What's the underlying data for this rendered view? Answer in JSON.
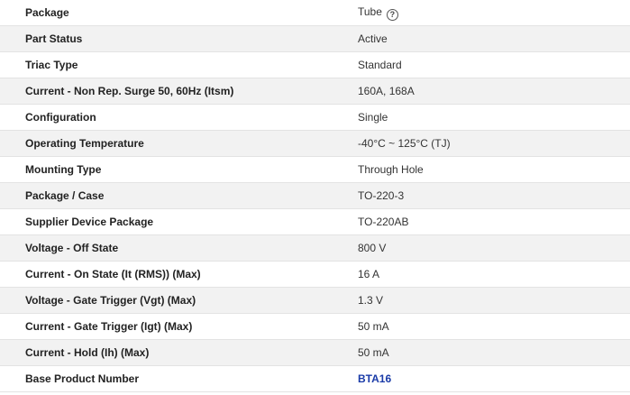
{
  "specs": [
    {
      "attribute": "Package",
      "value": "Tube",
      "help_icon": "question-circle-icon"
    },
    {
      "attribute": "Part Status",
      "value": "Active"
    },
    {
      "attribute": "Triac Type",
      "value": "Standard"
    },
    {
      "attribute": "Current - Non Rep. Surge 50, 60Hz (Itsm)",
      "value": "160A, 168A"
    },
    {
      "attribute": "Configuration",
      "value": "Single"
    },
    {
      "attribute": "Operating Temperature",
      "value": "-40°C ~ 125°C (TJ)"
    },
    {
      "attribute": "Mounting Type",
      "value": "Through Hole"
    },
    {
      "attribute": "Package / Case",
      "value": "TO-220-3"
    },
    {
      "attribute": "Supplier Device Package",
      "value": "TO-220AB"
    },
    {
      "attribute": "Voltage - Off State",
      "value": "800 V"
    },
    {
      "attribute": "Current - On State (It (RMS)) (Max)",
      "value": "16 A"
    },
    {
      "attribute": "Voltage - Gate Trigger (Vgt) (Max)",
      "value": "1.3 V"
    },
    {
      "attribute": "Current - Gate Trigger (Igt) (Max)",
      "value": "50 mA"
    },
    {
      "attribute": "Current - Hold (Ih) (Max)",
      "value": "50 mA"
    },
    {
      "attribute": "Base Product Number",
      "value": "BTA16",
      "link_color": "#1a3ba8"
    }
  ]
}
